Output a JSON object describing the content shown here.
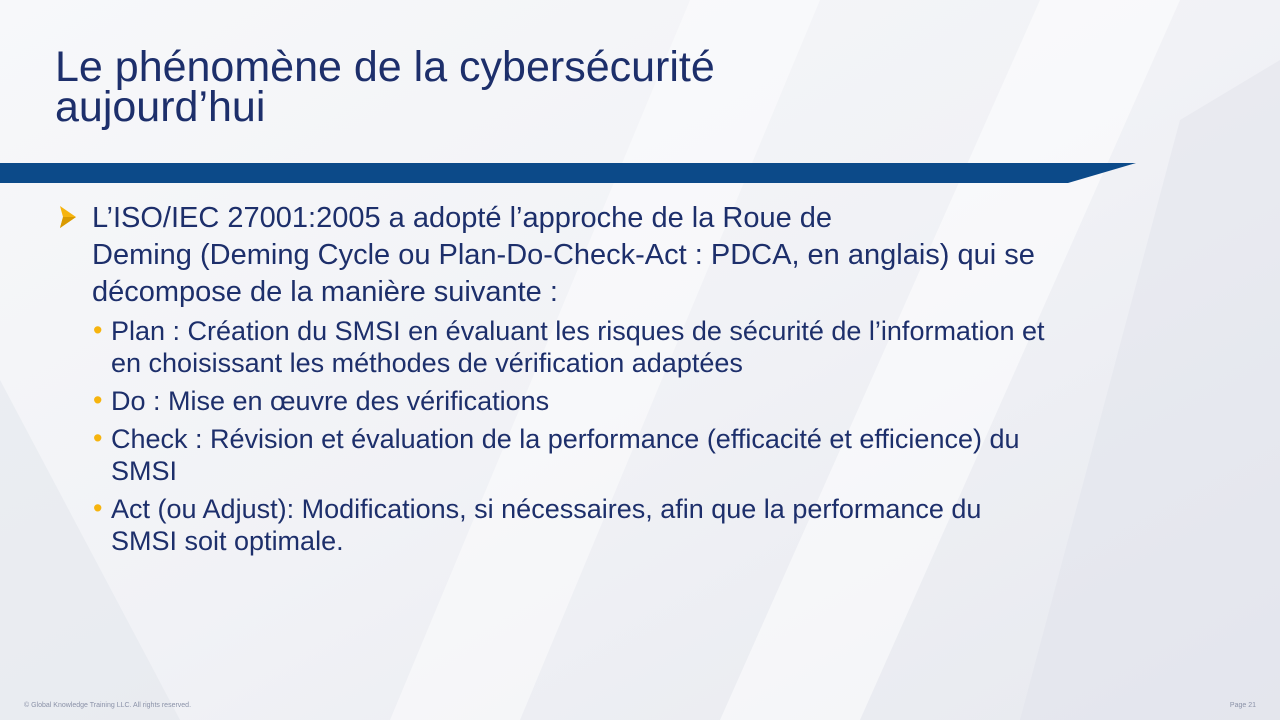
{
  "slide": {
    "title_lines": [
      "Le phénomène de la cybersécurité",
      "aujourd’hui"
    ],
    "main_bullet": {
      "lines": [
        "L’ISO/IEC 27001:2005 a adopté l’approche de la Roue de",
        "Deming (Deming Cycle ou Plan-Do-Check-Act : PDCA, en anglais) qui se",
        "décompose de la manière suivante :"
      ]
    },
    "sub_bullets": [
      {
        "lines": [
          "Plan : Création du SMSI en évaluant les risques de sécurité de l’information et",
          "en choisissant les méthodes de vérification adaptées"
        ]
      },
      {
        "lines": [
          "Do : Mise en œuvre des vérifications"
        ]
      },
      {
        "lines": [
          "Check : Révision et évaluation de la performance (efficacité et efficience) du",
          "SMSI"
        ]
      },
      {
        "lines": [
          "Act (ou Adjust): Modifications, si nécessaires, afin que la performance du",
          "SMSI soit optimale."
        ]
      }
    ],
    "bullet_symbol": "•",
    "footer": {
      "copyright": "© Global Knowledge  Training LLC. All rights reserved.",
      "page": "Page  21"
    }
  },
  "colors": {
    "title": "#1d2f6b",
    "band": "#0c4a89",
    "accent": "#f6b40e"
  },
  "icons": {
    "main_bullet": "arrowhead-bullet-icon"
  }
}
